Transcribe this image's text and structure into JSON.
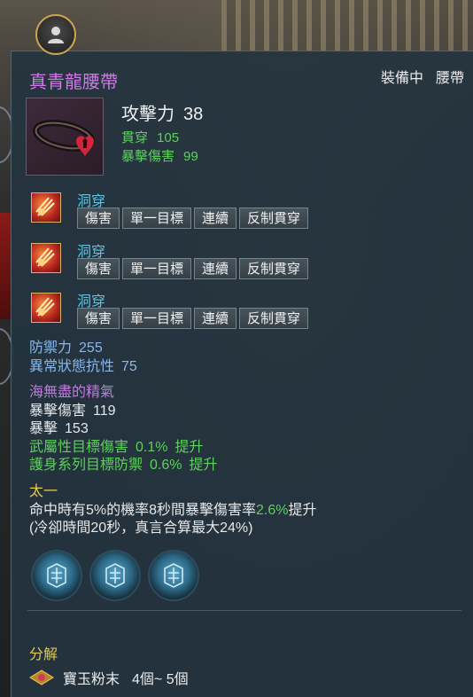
{
  "item": {
    "name": "真青龍腰帶",
    "status": "裝備中",
    "slot": "腰帶"
  },
  "main_stats": {
    "attack_label": "攻擊力",
    "attack_value": "38",
    "penetration_label": "貫穿",
    "penetration_value": "105",
    "crit_damage_label": "暴擊傷害",
    "crit_damage_value": "99"
  },
  "skills": [
    {
      "name": "洞穿",
      "tags": [
        "傷害",
        "單一目標",
        "連續",
        "反制貫穿"
      ],
      "icon": "flame-strike-icon"
    },
    {
      "name": "洞穿",
      "tags": [
        "傷害",
        "單一目標",
        "連續",
        "反制貫穿"
      ],
      "icon": "flame-strike-icon"
    },
    {
      "name": "洞穿",
      "tags": [
        "傷害",
        "單一目標",
        "連續",
        "反制貫穿"
      ],
      "icon": "flame-strike-icon"
    }
  ],
  "defense": {
    "defense_label": "防禦力",
    "defense_value": "255",
    "abnormal_label": "異常狀態抗性",
    "abnormal_value": "75"
  },
  "set_bonus": {
    "name": "海無盡的精氣",
    "crit_damage_label": "暴擊傷害",
    "crit_damage_value": "119",
    "crit_label": "暴擊",
    "crit_value": "153",
    "line1": "武屬性目標傷害",
    "line1_value": "0.1%",
    "line1_suffix": "提升",
    "line2": "護身系列目標防禦",
    "line2_value": "0.6%",
    "line2_suffix": "提升"
  },
  "effect": {
    "name": "太一",
    "desc_prefix": "命中時有5%的機率8秒間暴擊傷害率",
    "desc_value": "2.6%",
    "desc_suffix": "提升",
    "desc_line2": "(冷卻時間20秒，真言合算最大24%)"
  },
  "gems": [
    {
      "icon": "dragon-gem-icon"
    },
    {
      "icon": "dragon-gem-icon"
    },
    {
      "icon": "dragon-gem-icon"
    }
  ],
  "decompose": {
    "label": "分解",
    "material_name": "寶玉粉末",
    "material_qty": "4個~ 5個",
    "material_icon": "gem-powder-icon"
  },
  "colors": {
    "title": "#d07ae8",
    "green": "#5fcf5f",
    "skill": "#59c8e8",
    "yellow": "#e2c94f",
    "blue": "#8ab6ea"
  }
}
